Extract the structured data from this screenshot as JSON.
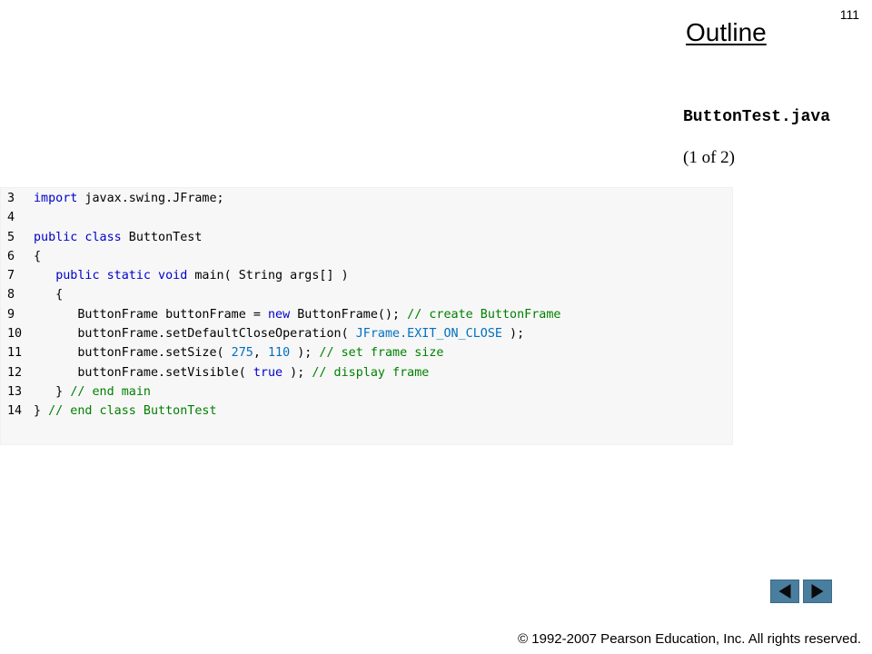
{
  "header": {
    "page_number": "111",
    "outline_title": "Outline",
    "filename": "ButtonTest.java",
    "part": "(1 of 2)"
  },
  "code": {
    "lines": [
      {
        "num": "3",
        "tokens": [
          {
            "t": "import javax.swing.JFrame;",
            "c": "kw-import"
          }
        ]
      },
      {
        "num": "4",
        "tokens": []
      },
      {
        "num": "5",
        "tokens": [
          {
            "t": "public class",
            "c": "kw"
          },
          {
            "t": " ButtonTest",
            "c": ""
          }
        ]
      },
      {
        "num": "6",
        "tokens": [
          {
            "t": "{",
            "c": ""
          }
        ]
      },
      {
        "num": "7",
        "tokens": [
          {
            "t": "   ",
            "c": ""
          },
          {
            "t": "public static void",
            "c": "kw"
          },
          {
            "t": " main( String args[] )",
            "c": ""
          }
        ]
      },
      {
        "num": "8",
        "tokens": [
          {
            "t": "   {",
            "c": ""
          }
        ]
      },
      {
        "num": "9",
        "tokens": [
          {
            "t": "      ButtonFrame buttonFrame = ",
            "c": ""
          },
          {
            "t": "new",
            "c": "kw"
          },
          {
            "t": " ButtonFrame(); ",
            "c": ""
          },
          {
            "t": "// create ButtonFrame",
            "c": "cm"
          }
        ]
      },
      {
        "num": "10",
        "tokens": [
          {
            "t": "      buttonFrame.setDefaultCloseOperation( ",
            "c": ""
          },
          {
            "t": "JFrame.EXIT_ON_CLOSE",
            "c": "lit"
          },
          {
            "t": " );",
            "c": ""
          }
        ]
      },
      {
        "num": "11",
        "tokens": [
          {
            "t": "      buttonFrame.setSize( ",
            "c": ""
          },
          {
            "t": "275",
            "c": "lit"
          },
          {
            "t": ", ",
            "c": ""
          },
          {
            "t": "110",
            "c": "lit"
          },
          {
            "t": " ); ",
            "c": ""
          },
          {
            "t": "// set frame size",
            "c": "cm"
          }
        ]
      },
      {
        "num": "12",
        "tokens": [
          {
            "t": "      buttonFrame.setVisible( ",
            "c": ""
          },
          {
            "t": "true",
            "c": "kw"
          },
          {
            "t": " ); ",
            "c": ""
          },
          {
            "t": "// display frame",
            "c": "cm"
          }
        ]
      },
      {
        "num": "13",
        "tokens": [
          {
            "t": "   } ",
            "c": ""
          },
          {
            "t": "// end main",
            "c": "cm"
          }
        ]
      },
      {
        "num": "14",
        "tokens": [
          {
            "t": "} ",
            "c": ""
          },
          {
            "t": "// end class ButtonTest",
            "c": "cm"
          }
        ]
      }
    ]
  },
  "navigation": {
    "prev_icon": "left-triangle-icon",
    "next_icon": "right-triangle-icon"
  },
  "footer": {
    "copyright": "© 1992-2007 Pearson Education, Inc.  All rights reserved."
  },
  "colors": {
    "keyword": "#0000cc",
    "comment": "#008000",
    "literal": "#0070c0",
    "code_background": "#f7f7f7",
    "nav_button": "#4a7e9e"
  }
}
